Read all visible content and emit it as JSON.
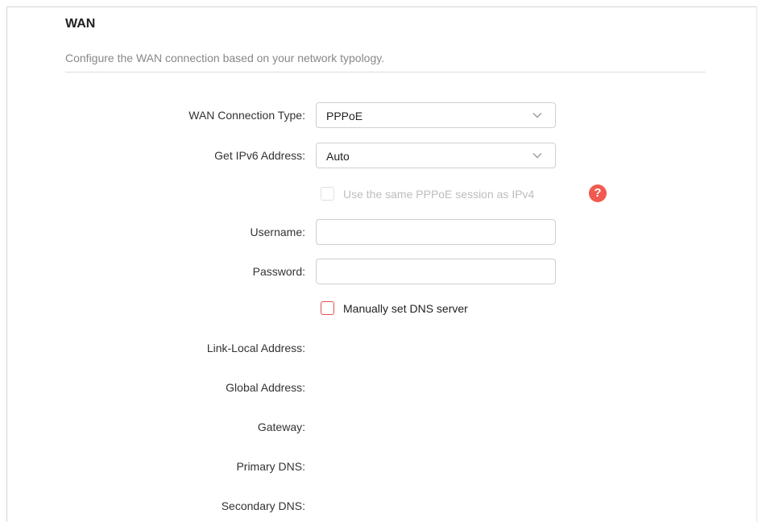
{
  "section": {
    "title": "WAN",
    "description": "Configure the WAN connection based on your network typology."
  },
  "form": {
    "wan_connection_type": {
      "label": "WAN Connection Type:",
      "value": "PPPoE"
    },
    "get_ipv6_address": {
      "label": "Get IPv6 Address:",
      "value": "Auto"
    },
    "same_session": {
      "label": "Use the same PPPoE session as IPv4",
      "checked": false,
      "disabled": true
    },
    "username": {
      "label": "Username:",
      "value": ""
    },
    "password": {
      "label": "Password:",
      "value": ""
    },
    "manual_dns": {
      "label": "Manually set DNS server",
      "checked": false
    }
  },
  "status": {
    "link_local_address": {
      "label": "Link-Local Address:",
      "value": ""
    },
    "global_address": {
      "label": "Global Address:",
      "value": ""
    },
    "gateway": {
      "label": "Gateway:",
      "value": ""
    },
    "primary_dns": {
      "label": "Primary DNS:",
      "value": ""
    },
    "secondary_dns": {
      "label": "Secondary DNS:",
      "value": ""
    }
  },
  "icons": {
    "help": "question-mark-icon",
    "dropdown": "chevron-down-icon"
  },
  "colors": {
    "accent": "#f05a4f",
    "checkbox_border": "#e0524f",
    "muted_text": "#888888",
    "disabled_text": "#bdbdbd"
  }
}
